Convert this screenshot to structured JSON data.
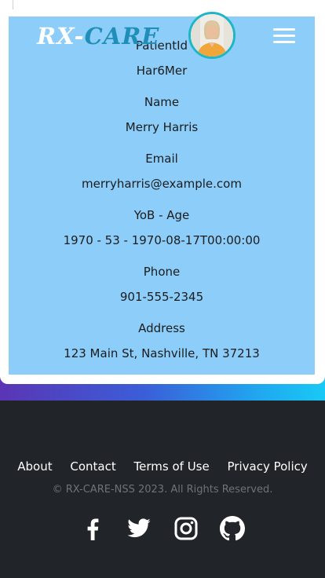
{
  "header": {
    "logo_rx": "RX-",
    "logo_care": "CARE"
  },
  "patient": {
    "patient_id_label": "PatientId",
    "patient_id_value": "Har6Mer",
    "name_label": "Name",
    "name_value": "Merry Harris",
    "email_label": "Email",
    "email_value": "merryharris@example.com",
    "yob_label": "YoB - Age",
    "yob_value": "1970 - 53 - 1970-08-17T00:00:00",
    "phone_label": "Phone",
    "phone_value": "901-555-2345",
    "address_label": "Address",
    "address_value": "123 Main St, Nashville, TN 37213"
  },
  "footer": {
    "links": [
      "About",
      "Contact",
      "Terms of Use",
      "Privacy Policy"
    ],
    "copyright": "© RX-CARE-NSS 2023. All Rights Reserved."
  },
  "icons": [
    "facebook-icon",
    "twitter-icon",
    "instagram-icon",
    "github-icon"
  ],
  "colors": {
    "panel_bg": "#8ccdf9",
    "footer_bg": "#212428",
    "avatar_ring": "#1db5c8",
    "logo_care": "#1f8fb8"
  }
}
